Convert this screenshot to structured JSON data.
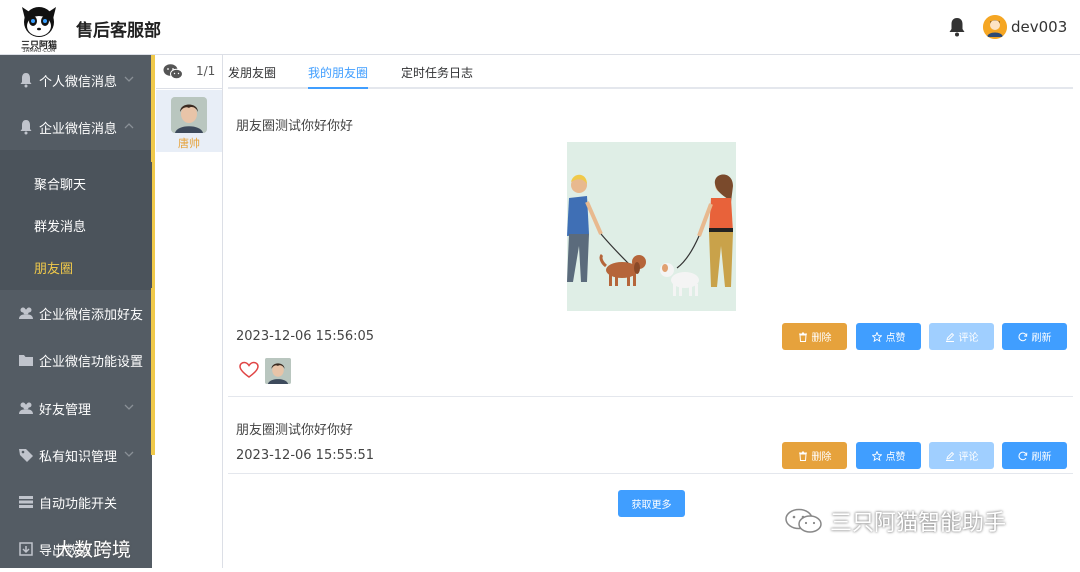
{
  "header": {
    "logo_text": "三只阿猫",
    "logo_sub": "3AMAO·COM",
    "title": "售后客服部",
    "username": "dev003"
  },
  "sidebar": {
    "items": [
      {
        "label": "个人微信消息",
        "icon": "bell-icon"
      },
      {
        "label": "企业微信消息",
        "icon": "bell-icon"
      },
      {
        "label": "企业微信添加好友",
        "icon": "users-icon"
      },
      {
        "label": "企业微信功能设置",
        "icon": "folder-icon"
      },
      {
        "label": "好友管理",
        "icon": "users-icon"
      },
      {
        "label": "私有知识管理",
        "icon": "tag-icon"
      },
      {
        "label": "自动功能开关",
        "icon": "server-icon"
      },
      {
        "label": "导出数据",
        "icon": "export-icon"
      }
    ],
    "subitems": [
      {
        "label": "聚合聊天"
      },
      {
        "label": "群发消息"
      },
      {
        "label": "朋友圈"
      }
    ]
  },
  "friends": {
    "count": "1/1",
    "items": [
      {
        "name": "唐帅"
      }
    ]
  },
  "tabs": [
    {
      "label": "发朋友圈"
    },
    {
      "label": "我的朋友圈"
    },
    {
      "label": "定时任务日志"
    }
  ],
  "posts": [
    {
      "text": "朋友圈测试你好你好",
      "time": "2023-12-06 15:56:05"
    },
    {
      "text": "朋友圈测试你好你好",
      "time": "2023-12-06 15:55:51"
    }
  ],
  "buttons": {
    "delete": "删除",
    "like": "点赞",
    "comment": "评论",
    "refresh": "刷新",
    "more": "获取更多"
  },
  "watermarks": {
    "wechat_account": "三只阿猫智能助手",
    "corner": "大数跨境"
  },
  "colors": {
    "sidebar_bg": "#545c64",
    "accent_yellow": "#f0c94a",
    "primary_blue": "#409eff",
    "warning_orange": "#e6a23c"
  }
}
